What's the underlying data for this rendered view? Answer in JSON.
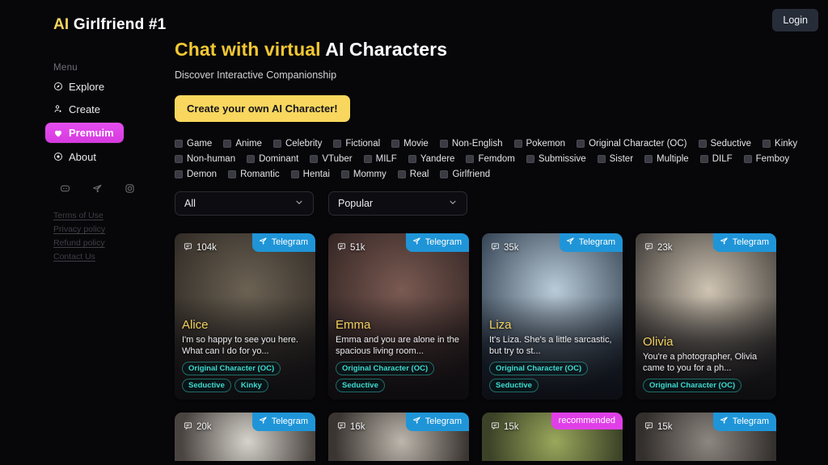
{
  "brand": {
    "accent_text": "AI",
    "rest_text": " Girlfriend #1",
    "accent_color": "#f5d661"
  },
  "header": {
    "login_label": "Login"
  },
  "sidebar": {
    "menu_label": "Menu",
    "items": [
      {
        "label": "Explore",
        "icon": "compass-icon",
        "active": false
      },
      {
        "label": "Create",
        "icon": "user-plus-icon",
        "active": false
      },
      {
        "label": "Premuim",
        "icon": "heart-icon",
        "active": true
      },
      {
        "label": "About",
        "icon": "info-circle-icon",
        "active": false
      }
    ],
    "socials": [
      {
        "name": "discord-icon"
      },
      {
        "name": "telegram-icon"
      },
      {
        "name": "instagram-icon"
      }
    ],
    "legal": [
      {
        "label": "Terms of Use"
      },
      {
        "label": "Privacy policy"
      },
      {
        "label": "Refund policy"
      },
      {
        "label": "Contact Us"
      }
    ]
  },
  "main": {
    "title_accent": "Chat with virtual",
    "title_rest": " AI Characters",
    "subtitle": "Discover Interactive Companionship",
    "cta_label": "Create your own AI Character!",
    "filters": [
      "Game",
      "Anime",
      "Celebrity",
      "Fictional",
      "Movie",
      "Non-English",
      "Pokemon",
      "Original Character (OC)",
      "Seductive",
      "Kinky",
      "Non-human",
      "Dominant",
      "VTuber",
      "MILF",
      "Yandere",
      "Femdom",
      "Submissive",
      "Sister",
      "Multiple",
      "DILF",
      "Femboy",
      "Demon",
      "Romantic",
      "Hentai",
      "Mommy",
      "Real",
      "Girlfriend"
    ],
    "selects": [
      {
        "name": "category-select",
        "value": "All"
      },
      {
        "name": "sort-select",
        "value": "Popular"
      }
    ],
    "telegram_label": "Telegram",
    "recommended_label": "recommended"
  },
  "cards": [
    {
      "name": "Alice",
      "views": "104k",
      "desc": "I'm so happy to see you here. What can I do for yo...",
      "tags": [
        "Original Character (OC)",
        "Seductive",
        "Kinky"
      ],
      "badge": "telegram",
      "art_from": "#6b6253",
      "art_to": "#2a2420"
    },
    {
      "name": "Emma",
      "views": "51k",
      "desc": "Emma and you are alone in the spacious living room...",
      "tags": [
        "Original Character (OC)",
        "Seductive"
      ],
      "badge": "telegram",
      "art_from": "#7a5a52",
      "art_to": "#2b1f1e"
    },
    {
      "name": "Liza",
      "views": "35k",
      "desc": "It's Liza. She's a little sarcastic, but try to st...",
      "tags": [
        "Original Character (OC)",
        "Seductive"
      ],
      "badge": "telegram",
      "art_from": "#b9cbd8",
      "art_to": "#243243"
    },
    {
      "name": "Olivia",
      "views": "23k",
      "desc": "You're a photographer, Olivia came to you for a ph...",
      "tags": [
        "Original Character (OC)"
      ],
      "badge": "telegram",
      "art_from": "#cfc4b3",
      "art_to": "#2d2a28"
    }
  ],
  "cards_row2": [
    {
      "views": "20k",
      "badge": "telegram",
      "art_from": "#d6d3cc",
      "art_to": "#4a4440"
    },
    {
      "views": "16k",
      "badge": "telegram",
      "art_from": "#bdb6ad",
      "art_to": "#3a3531"
    },
    {
      "views": "15k",
      "badge": "recommended",
      "art_from": "#9aa85c",
      "art_to": "#3b4227"
    },
    {
      "views": "15k",
      "badge": "telegram",
      "art_from": "#8d8781",
      "art_to": "#332f2c"
    }
  ]
}
